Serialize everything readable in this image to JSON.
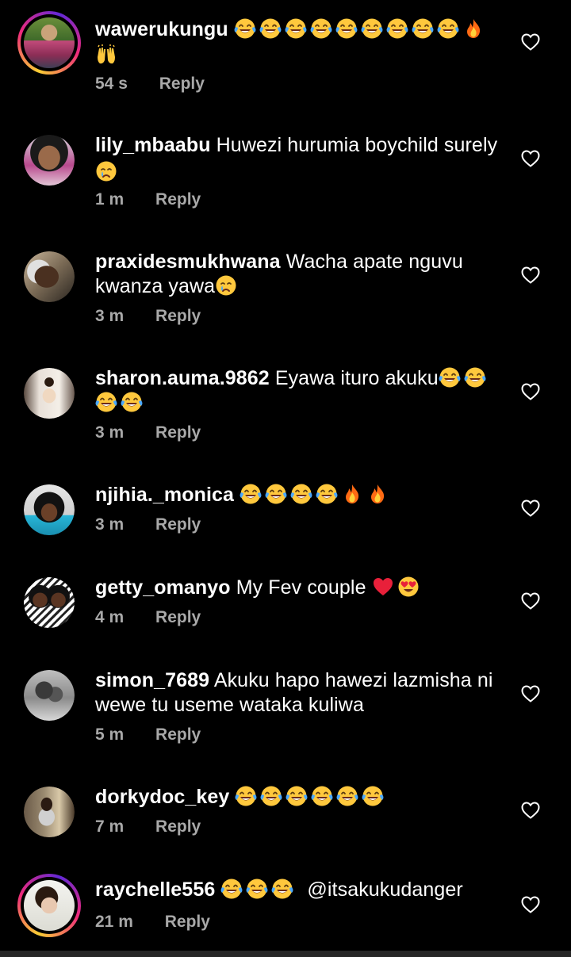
{
  "comments": [
    {
      "username": "wawerukungu",
      "text": "",
      "time": "54 s",
      "reply": "Reply",
      "emojis_line1": [
        "laugh-cry",
        "laugh-cry",
        "laugh-cry",
        "laugh-cry",
        "laugh-cry",
        "laugh-cry",
        "laugh-cry",
        "laugh-cry",
        "laugh-cry",
        "fire"
      ],
      "emojis_line2": [
        "raised-hands"
      ],
      "story_ring": true
    },
    {
      "username": "lily_mbaabu",
      "text": "Huwezi hurumia boychild surely",
      "time": "1 m",
      "reply": "Reply",
      "trailing_emojis": [
        "crying"
      ]
    },
    {
      "username": "praxidesmukhwana",
      "text": "Wacha apate nguvu",
      "text2": "kwanza yawa",
      "time": "3 m",
      "reply": "Reply",
      "trailing_emojis": [
        "crying"
      ]
    },
    {
      "username": "sharon.auma.9862",
      "text": "Eyawa ituro akuku",
      "time": "3 m",
      "reply": "Reply",
      "trailing_emojis": [
        "laugh-cry",
        "laugh-cry",
        "laugh-cry",
        "laugh-cry"
      ]
    },
    {
      "username": "njihia._monica",
      "text": "",
      "time": "3 m",
      "reply": "Reply",
      "trailing_emojis": [
        "laugh-cry",
        "laugh-cry",
        "laugh-cry",
        "laugh-cry",
        "fire",
        "fire"
      ]
    },
    {
      "username": "getty_omanyo",
      "text": "My Fev couple",
      "time": "4 m",
      "reply": "Reply",
      "trailing_emojis": [
        "red-heart",
        "heart-eyes"
      ]
    },
    {
      "username": "simon_7689",
      "text": "Akuku hapo hawezi lazmisha ni",
      "text2": "wewe tu useme wataka kuliwa",
      "time": "5 m",
      "reply": "Reply"
    },
    {
      "username": "dorkydoc_key",
      "text": "",
      "time": "7 m",
      "reply": "Reply",
      "trailing_emojis": [
        "laugh-cry",
        "laugh-cry",
        "laugh-cry",
        "laugh-cry",
        "laugh-cry",
        "laugh-cry"
      ]
    },
    {
      "username": "raychelle556",
      "text": "@itsakukudanger",
      "time": "21 m",
      "reply": "Reply",
      "leading_emojis": [
        "laugh-cry",
        "laugh-cry",
        "laugh-cry"
      ],
      "story_ring": true
    }
  ],
  "colors": {
    "background": "#000000",
    "text": "#ffffff",
    "meta": "#a8a8a8"
  }
}
